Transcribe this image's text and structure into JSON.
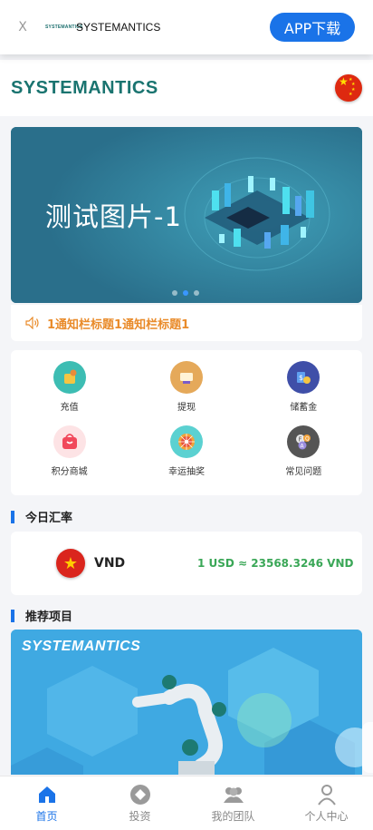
{
  "top_bar": {
    "close": "X",
    "mini_logo": "SYSTEMANTICS",
    "app_name": "SYSTEMANTICS",
    "download_button": "APP下载"
  },
  "header": {
    "brand": "SYSTEMANTICS",
    "language_flag": "china-flag-icon"
  },
  "banner": {
    "text": "测试图片-1",
    "slides": 3,
    "active_slide": 2
  },
  "notice": {
    "icon": "speaker-icon",
    "text": "1通知栏标题1通知栏标题1"
  },
  "menu": [
    {
      "label": "充值",
      "icon": "recharge-icon",
      "color": "#3dbdb3"
    },
    {
      "label": "提现",
      "icon": "withdraw-icon",
      "color": "#e5a95a"
    },
    {
      "label": "储蓄金",
      "icon": "savings-icon",
      "color": "#3f4fa8"
    },
    {
      "label": "积分商城",
      "icon": "shopping-bag-icon",
      "color": "#f1485b"
    },
    {
      "label": "幸运抽奖",
      "icon": "lucky-wheel-icon",
      "color": "#5bd1d1"
    },
    {
      "label": "常见问题",
      "icon": "faq-icon",
      "color": "#555555"
    }
  ],
  "exchange": {
    "title": "今日汇率",
    "currency": "VND",
    "rate": "1 USD ≈ 23568.3246 VND",
    "flag": "vietnam-flag-icon"
  },
  "projects": {
    "title": "推荐项目",
    "card_logo": "SYSTEMANTICS"
  },
  "tabbar": [
    {
      "label": "首页",
      "icon": "home-icon",
      "active": true
    },
    {
      "label": "投资",
      "icon": "invest-icon",
      "active": false
    },
    {
      "label": "我的团队",
      "icon": "team-icon",
      "active": false
    },
    {
      "label": "个人中心",
      "icon": "profile-icon",
      "active": false
    }
  ],
  "colors": {
    "accent": "#1a73e8",
    "brand": "#1a7470",
    "notice": "#e98b2a",
    "rate": "#3aa757"
  }
}
